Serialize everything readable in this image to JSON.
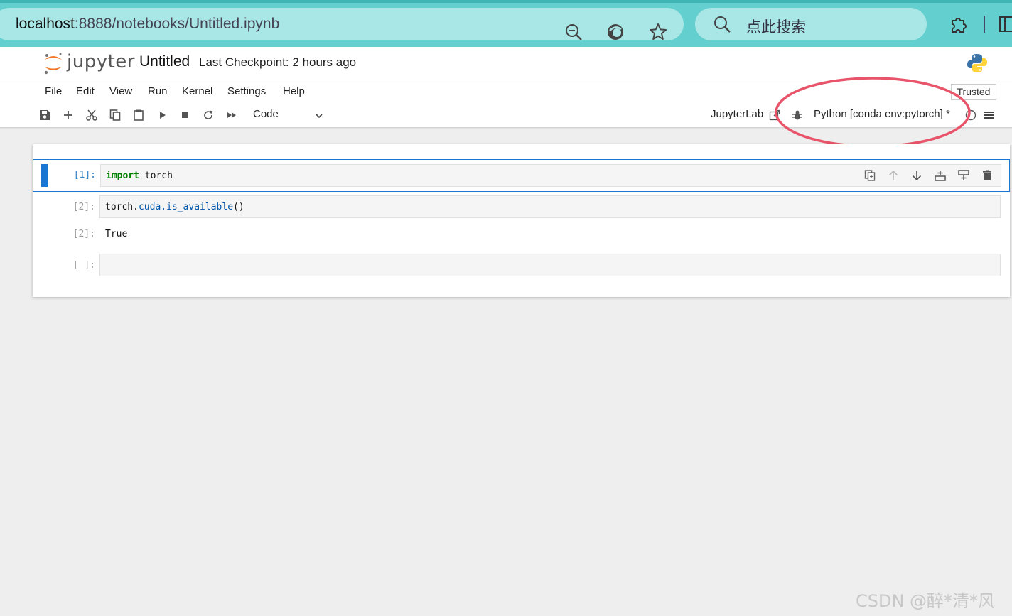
{
  "browser": {
    "url_host": "localhost",
    "url_rest": ":8888/notebooks/Untitled.ipynb",
    "search_placeholder": "点此搜索"
  },
  "header": {
    "wordmark": "jupyter",
    "notebook_title": "Untitled",
    "checkpoint": "Last Checkpoint: 2 hours ago"
  },
  "menu": {
    "items": [
      "File",
      "Edit",
      "View",
      "Run",
      "Kernel",
      "Settings",
      "Help"
    ],
    "trusted": "Trusted"
  },
  "toolbar": {
    "cell_type": "Code",
    "jupyterlab_label": "JupyterLab",
    "kernel_name": "Python [conda env:pytorch] *"
  },
  "cells": [
    {
      "prompt": "[1]:",
      "code_keyword": "import",
      "code_rest": " torch",
      "active": true
    },
    {
      "prompt": "[2]:",
      "code_obj": "torch.",
      "code_attr": "cuda.is_available",
      "code_tail": "()",
      "output_prompt": "[2]:",
      "output": "True"
    },
    {
      "prompt": "[ ]:",
      "code": ""
    }
  ],
  "watermark": "CSDN @醉*清*风",
  "colors": {
    "browser_bar": "#63cfcf",
    "url_pill": "#a9e6e6",
    "active_cell": "#1976d2",
    "annotation": "#e8546a",
    "jupyter_orange": "#f37726"
  }
}
